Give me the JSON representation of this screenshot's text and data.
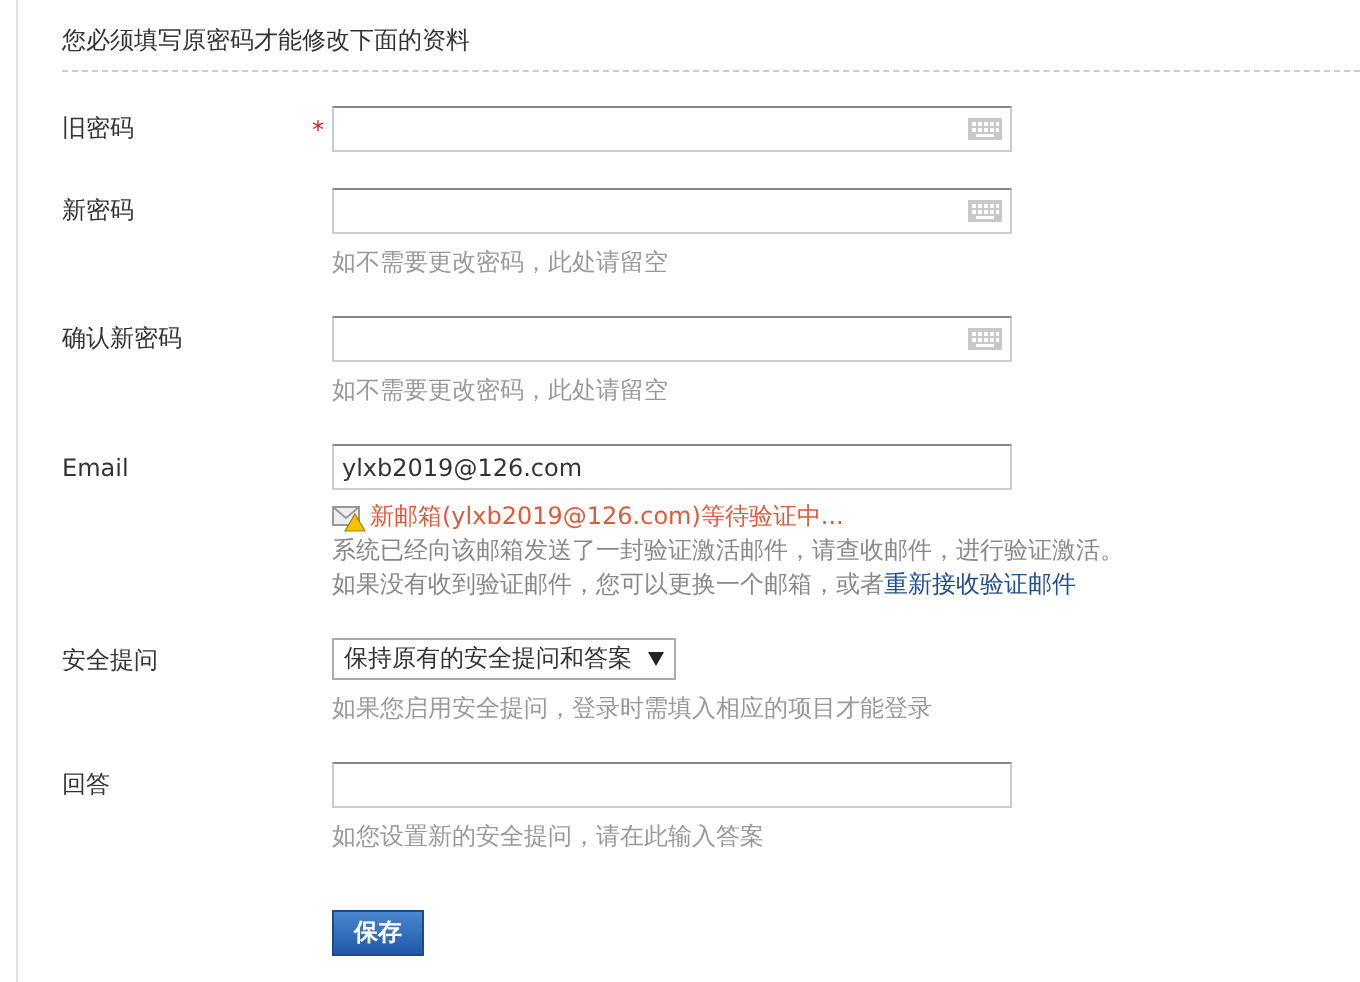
{
  "heading": "您必须填写原密码才能修改下面的资料",
  "fields": [
    {
      "kind": "password",
      "label": "旧密码",
      "required": true,
      "required_mark": "*"
    },
    {
      "kind": "password",
      "label": "新密码",
      "required": false,
      "hint": "如不需要更改密码，此处请留空"
    },
    {
      "kind": "password",
      "label": "确认新密码",
      "required": false,
      "hint": "如不需要更改密码，此处请留空"
    },
    {
      "kind": "email",
      "label": "Email",
      "required": false,
      "value": "ylxb2019@126.com",
      "status": "新邮箱(ylxb2019@126.com)等待验证中...",
      "notes": [
        "系统已经向该邮箱发送了一封验证激活邮件，请查收邮件，进行验证激活。",
        "如果没有收到验证邮件，您可以更换一个邮箱，或者"
      ],
      "link": "重新接收验证邮件"
    },
    {
      "kind": "select",
      "label": "安全提问",
      "required": false,
      "value": "保持原有的安全提问和答案",
      "hint": "如果您启用安全提问，登录时需填入相应的项目才能登录"
    },
    {
      "kind": "text",
      "label": "回答",
      "required": false,
      "hint": "如您设置新的安全提问，请在此输入答案"
    }
  ],
  "button": "保存"
}
